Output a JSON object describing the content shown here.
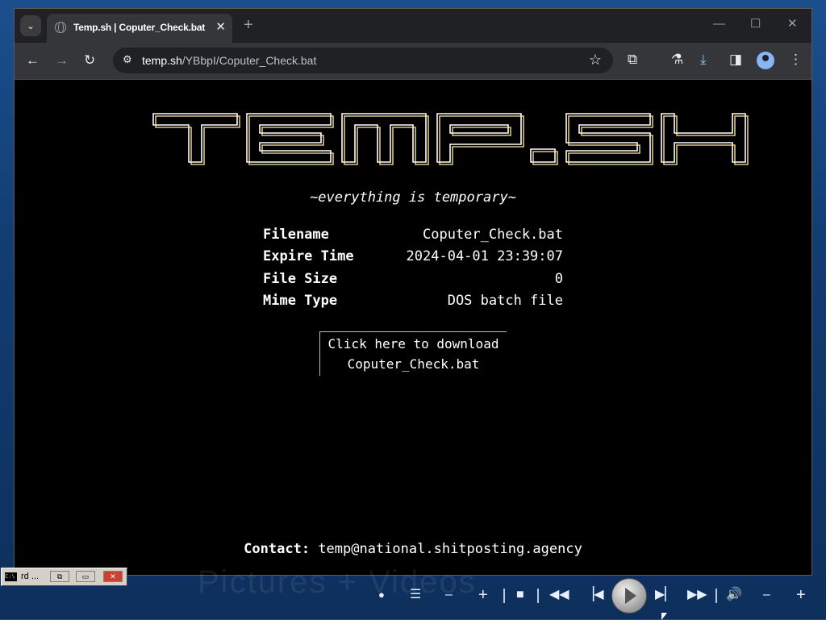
{
  "browser": {
    "tab_menu_icon": "chevron-down-icon",
    "tab_title": "Temp.sh | Coputer_Check.bat",
    "url_host": "temp.sh",
    "url_path": "/YBbpI/Coputer_Check.bat"
  },
  "page": {
    "logo_text": "TEMP.SH",
    "tagline": "~everything is temporary~",
    "info": [
      {
        "label": "Filename",
        "value": "Coputer_Check.bat"
      },
      {
        "label": "Expire Time",
        "value": "2024-04-01 23:39:07"
      },
      {
        "label": "File Size",
        "value": "0"
      },
      {
        "label": "Mime Type",
        "value": "DOS batch file"
      }
    ],
    "download_line1": "Click here to download",
    "download_line2": "Coputer_Check.bat",
    "contact_label": "Contact:",
    "contact_email": "temp@national.shitposting.agency"
  },
  "desktop": {
    "background_text": "Pictures + Videos",
    "task_window_label": "rd ..."
  }
}
